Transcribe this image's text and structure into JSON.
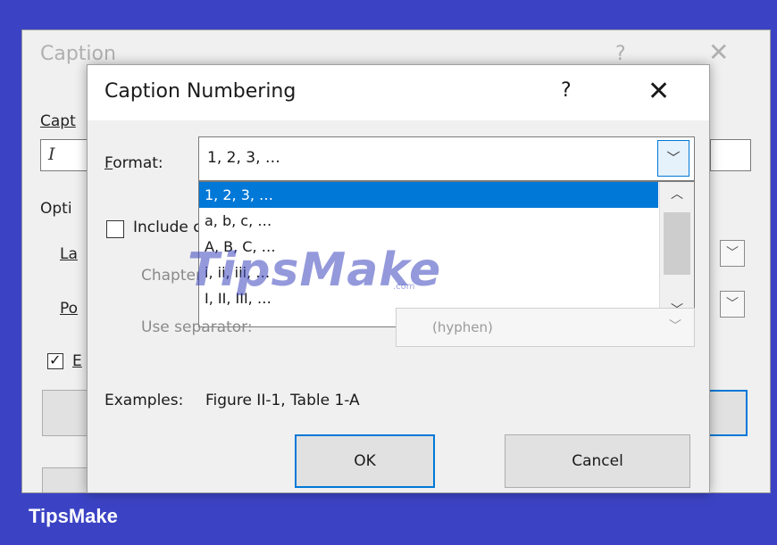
{
  "caption_dialog": {
    "title": "Caption",
    "help": "?",
    "close": "✕",
    "caption_label": "Capt",
    "caption_value": "I",
    "options_label": "Opti",
    "label_label": "La",
    "position_label": "Po",
    "exclude_checkbox_label": "E",
    "exclude_checked": true
  },
  "numbering_dialog": {
    "title": "Caption Numbering",
    "help": "?",
    "close": "✕",
    "format_label": "Format:",
    "format_value": "1, 2, 3, …",
    "format_options": [
      "1, 2, 3, …",
      "a, b, c, …",
      "A, B, C, …",
      "i, ii, iii, …",
      "I, II, III, …"
    ],
    "selected_option_index": 0,
    "include_chapter_label": "Include chapter number",
    "chapter_label": "Chapter starts with style",
    "separator_label": "Use separator:",
    "separator_value": "(hyphen)",
    "include_chapter_checked": false,
    "examples_label": "Examples:",
    "examples_value": "Figure II-1, Table 1-A",
    "ok_label": "OK",
    "cancel_label": "Cancel"
  },
  "watermark": {
    "text": "TipsMake",
    "sub": ".com"
  },
  "footer": {
    "brand": "TipsMake"
  },
  "colors": {
    "background": "#3b43c4",
    "accent": "#0078d7",
    "dialog": "#f0f0f0"
  }
}
